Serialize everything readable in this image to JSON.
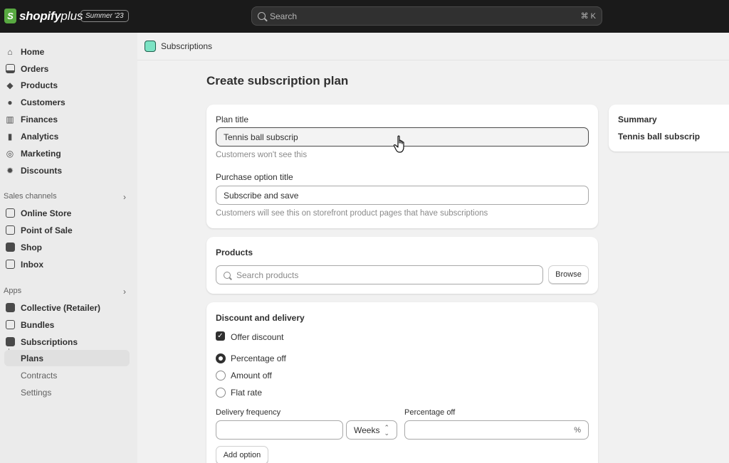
{
  "topbar": {
    "brand": "shopify",
    "brand_plus": "plus",
    "edition": "Summer '23",
    "search_placeholder": "Search",
    "search_shortcut": "⌘ K"
  },
  "sidebar": {
    "main_items": [
      {
        "label": "Home",
        "icon": "home-icon"
      },
      {
        "label": "Orders",
        "icon": "inbox-tray-icon"
      },
      {
        "label": "Products",
        "icon": "tag-icon"
      },
      {
        "label": "Customers",
        "icon": "person-icon"
      },
      {
        "label": "Finances",
        "icon": "bank-icon"
      },
      {
        "label": "Analytics",
        "icon": "bar-chart-icon"
      },
      {
        "label": "Marketing",
        "icon": "target-icon"
      },
      {
        "label": "Discounts",
        "icon": "discount-badge-icon"
      }
    ],
    "sales_channels_heading": "Sales channels",
    "sales_channels": [
      {
        "label": "Online Store",
        "icon": "store-icon"
      },
      {
        "label": "Point of Sale",
        "icon": "pos-icon"
      },
      {
        "label": "Shop",
        "icon": "shop-icon"
      },
      {
        "label": "Inbox",
        "icon": "chat-inbox-icon"
      }
    ],
    "apps_heading": "Apps",
    "apps": [
      {
        "label": "Collective (Retailer)",
        "icon": "collective-icon"
      },
      {
        "label": "Bundles",
        "icon": "bundles-icon"
      },
      {
        "label": "Subscriptions",
        "icon": "subscriptions-icon"
      }
    ],
    "sub_items": [
      "Plans",
      "Contracts",
      "Settings"
    ]
  },
  "header": {
    "app_name": "Subscriptions"
  },
  "page": {
    "title": "Create subscription plan"
  },
  "plan_card": {
    "plan_title_label": "Plan title",
    "plan_title_value": "Tennis ball subscrip",
    "plan_title_help": "Customers won't see this",
    "purchase_label": "Purchase option title",
    "purchase_value": "Subscribe and save",
    "purchase_help": "Customers will see this on storefront product pages that have subscriptions"
  },
  "products_card": {
    "heading": "Products",
    "search_placeholder": "Search products",
    "browse_label": "Browse"
  },
  "discount_card": {
    "heading": "Discount and delivery",
    "offer_discount_label": "Offer discount",
    "offer_discount_checked": true,
    "options": [
      "Percentage off",
      "Amount off",
      "Flat rate"
    ],
    "selected_option": "Percentage off",
    "delivery_frequency_label": "Delivery frequency",
    "delivery_frequency_value": "",
    "interval_value": "Weeks",
    "percentage_label": "Percentage off",
    "percentage_value": "",
    "percentage_suffix": "%",
    "add_option_label": "Add option"
  },
  "summary": {
    "heading": "Summary",
    "plan_name": "Tennis ball subscrip"
  },
  "colors": {
    "topbar": "#1a1a1a",
    "sidebar": "#ebebeb",
    "brand_green": "#58a941",
    "text": "#303030"
  }
}
